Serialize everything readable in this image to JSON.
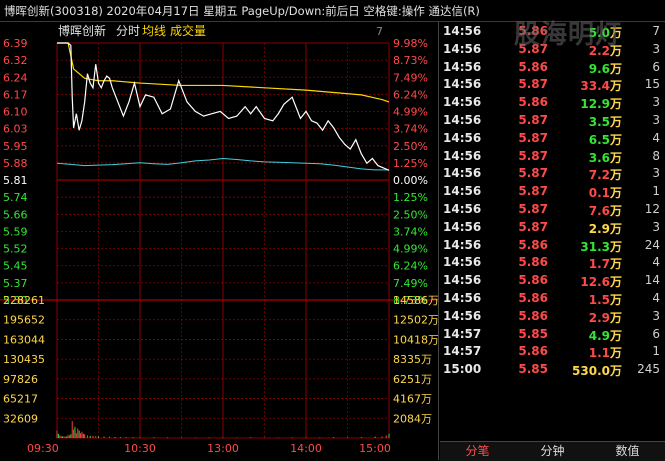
{
  "header": {
    "title": "博晖创新(300318)  2020年04月17日 星期五 PageUp/Down:前后日 空格键:操作 通达信(R)"
  },
  "watermark": "股海明灯",
  "legend": {
    "name": "博晖创新",
    "mode": "分时",
    "avg": "均线",
    "vol": "成交量",
    "corner": "7"
  },
  "colors": {
    "up": "#ff4a4a",
    "down": "#33e633",
    "base": "#ffffff",
    "price_line": "#ffffff",
    "avg_line": "#ffd700",
    "ref_line": "#40d0e0",
    "grid": "#8b0000",
    "volume_label": "#ffd84a"
  },
  "chart_data": {
    "type": "line",
    "base_price": 5.81,
    "price_ylim": [
      5.3,
      6.39
    ],
    "price_ticks_left": [
      "6.39",
      "6.32",
      "6.24",
      "6.17",
      "6.10",
      "6.03",
      "5.95",
      "5.88",
      "5.81",
      "5.74",
      "5.66",
      "5.59",
      "5.52",
      "5.45",
      "5.37",
      "5.30"
    ],
    "pct_ticks_right": [
      "9.98%",
      "8.73%",
      "7.49%",
      "6.24%",
      "4.99%",
      "3.74%",
      "2.50%",
      "1.25%",
      "0.00%",
      "1.25%",
      "2.50%",
      "3.74%",
      "4.99%",
      "6.24%",
      "7.49%",
      "8.73%"
    ],
    "volume_ticks_left": [
      "228261",
      "195652",
      "163044",
      "130435",
      "97826",
      "65217",
      "32609"
    ],
    "volume_ticks_right": [
      "14586万",
      "12502万",
      "10418万",
      "8335万",
      "6251万",
      "4167万",
      "2084万"
    ],
    "time_labels": [
      "09:30",
      "10:30",
      "13:00",
      "14:00",
      "15:00"
    ],
    "x_ticks": [
      0,
      60,
      120,
      180,
      240
    ],
    "volume_ylim": [
      0,
      260870
    ],
    "price_series": {
      "name": "博晖创新",
      "x": [
        0,
        3,
        6,
        8,
        10,
        11,
        12,
        14,
        16,
        18,
        20,
        22,
        24,
        26,
        28,
        30,
        32,
        34,
        36,
        38,
        40,
        44,
        48,
        52,
        56,
        60,
        64,
        70,
        76,
        82,
        88,
        94,
        100,
        106,
        112,
        118,
        124,
        130,
        136,
        140,
        144,
        150,
        156,
        160,
        164,
        170,
        176,
        180,
        184,
        188,
        192,
        196,
        200,
        204,
        208,
        212,
        216,
        220,
        224,
        228,
        232,
        236,
        240
      ],
      "y": [
        6.39,
        6.39,
        6.39,
        6.39,
        6.38,
        6.16,
        6.03,
        6.09,
        6.02,
        6.06,
        6.14,
        6.26,
        6.22,
        6.2,
        6.3,
        6.22,
        6.2,
        6.23,
        6.25,
        6.24,
        6.2,
        6.14,
        6.08,
        6.14,
        6.22,
        6.12,
        6.17,
        6.16,
        6.09,
        6.11,
        6.23,
        6.14,
        6.1,
        6.08,
        6.09,
        6.1,
        6.07,
        6.08,
        6.12,
        6.09,
        6.12,
        6.07,
        6.06,
        6.09,
        6.13,
        6.16,
        6.07,
        6.1,
        6.06,
        6.05,
        6.02,
        6.06,
        6.03,
        5.99,
        5.96,
        5.94,
        5.98,
        5.92,
        5.88,
        5.9,
        5.87,
        5.86,
        5.85
      ]
    },
    "avg_series": {
      "name": "均线",
      "x": [
        0,
        8,
        12,
        20,
        30,
        40,
        60,
        90,
        120,
        150,
        180,
        200,
        220,
        235,
        240
      ],
      "y": [
        6.39,
        6.39,
        6.28,
        6.24,
        6.23,
        6.23,
        6.22,
        6.21,
        6.21,
        6.2,
        6.19,
        6.18,
        6.17,
        6.15,
        6.14
      ]
    },
    "ref_series": {
      "x": [
        0,
        10,
        20,
        30,
        40,
        50,
        60,
        70,
        80,
        90,
        100,
        110,
        120,
        130,
        140,
        150,
        160,
        170,
        180,
        190,
        200,
        210,
        220,
        230,
        240
      ],
      "y": [
        5.88,
        5.875,
        5.87,
        5.872,
        5.874,
        5.878,
        5.882,
        5.878,
        5.875,
        5.882,
        5.89,
        5.894,
        5.9,
        5.896,
        5.89,
        5.886,
        5.884,
        5.882,
        5.88,
        5.878,
        5.872,
        5.864,
        5.856,
        5.852,
        5.852
      ]
    },
    "volume_series": {
      "x": [
        0,
        1,
        2,
        3,
        4,
        5,
        6,
        7,
        8,
        9,
        10,
        11,
        12,
        13,
        14,
        15,
        16,
        17,
        18,
        19,
        20,
        22,
        24,
        26,
        28,
        30,
        34,
        38,
        42,
        46,
        50,
        55,
        60,
        70,
        80,
        90,
        100,
        110,
        120,
        130,
        140,
        150,
        160,
        170,
        180,
        190,
        200,
        210,
        220,
        230,
        235,
        238,
        240
      ],
      "v": [
        14000,
        8000,
        5000,
        4000,
        3000,
        3000,
        2500,
        3000,
        6000,
        5000,
        7000,
        32000,
        16000,
        21000,
        9000,
        18000,
        14000,
        9000,
        12000,
        8000,
        7000,
        5000,
        4000,
        4000,
        3500,
        3000,
        3000,
        2500,
        2000,
        2000,
        2000,
        1500,
        1500,
        1500,
        1200,
        1200,
        1000,
        1000,
        1000,
        1000,
        1200,
        1000,
        1000,
        1000,
        1200,
        1200,
        1500,
        1500,
        2000,
        2500,
        3000,
        5000,
        8000
      ]
    }
  },
  "ticks": {
    "rows": [
      {
        "time": "14:56",
        "price": "5.86",
        "vol": "5.0",
        "unit": "万",
        "cnt": "7",
        "dir": "down"
      },
      {
        "time": "14:56",
        "price": "5.87",
        "vol": "2.2",
        "unit": "万",
        "cnt": "3",
        "dir": "up"
      },
      {
        "time": "14:56",
        "price": "5.86",
        "vol": "9.6",
        "unit": "万",
        "cnt": "6",
        "dir": "down"
      },
      {
        "time": "14:56",
        "price": "5.87",
        "vol": "33.4",
        "unit": "万",
        "cnt": "15",
        "dir": "up"
      },
      {
        "time": "14:56",
        "price": "5.86",
        "vol": "12.9",
        "unit": "万",
        "cnt": "3",
        "dir": "down"
      },
      {
        "time": "14:56",
        "price": "5.87",
        "vol": "3.5",
        "unit": "万",
        "cnt": "3",
        "dir": "down"
      },
      {
        "time": "14:56",
        "price": "5.87",
        "vol": "6.5",
        "unit": "万",
        "cnt": "4",
        "dir": "down"
      },
      {
        "time": "14:56",
        "price": "5.87",
        "vol": "3.6",
        "unit": "万",
        "cnt": "8",
        "dir": "down"
      },
      {
        "time": "14:56",
        "price": "5.87",
        "vol": "7.2",
        "unit": "万",
        "cnt": "3",
        "dir": "up"
      },
      {
        "time": "14:56",
        "price": "5.87",
        "vol": "0.1",
        "unit": "万",
        "cnt": "1",
        "dir": "up"
      },
      {
        "time": "14:56",
        "price": "5.87",
        "vol": "7.6",
        "unit": "万",
        "cnt": "12",
        "dir": "up"
      },
      {
        "time": "14:56",
        "price": "5.87",
        "vol": "2.9",
        "unit": "万",
        "cnt": "3",
        "dir": "flat"
      },
      {
        "time": "14:56",
        "price": "5.86",
        "vol": "31.3",
        "unit": "万",
        "cnt": "24",
        "dir": "down"
      },
      {
        "time": "14:56",
        "price": "5.86",
        "vol": "1.7",
        "unit": "万",
        "cnt": "4",
        "dir": "up"
      },
      {
        "time": "14:56",
        "price": "5.86",
        "vol": "12.6",
        "unit": "万",
        "cnt": "14",
        "dir": "up"
      },
      {
        "time": "14:56",
        "price": "5.86",
        "vol": "1.5",
        "unit": "万",
        "cnt": "4",
        "dir": "up"
      },
      {
        "time": "14:56",
        "price": "5.86",
        "vol": "2.9",
        "unit": "万",
        "cnt": "3",
        "dir": "up"
      },
      {
        "time": "14:57",
        "price": "5.85",
        "vol": "4.9",
        "unit": "万",
        "cnt": "6",
        "dir": "down"
      },
      {
        "time": "14:57",
        "price": "5.86",
        "vol": "1.1",
        "unit": "万",
        "cnt": "1",
        "dir": "up"
      },
      {
        "time": "15:00",
        "price": "5.85",
        "vol": "530.0",
        "unit": "万",
        "cnt": "245",
        "dir": "flat"
      }
    ]
  },
  "tabs": [
    {
      "label": "分笔",
      "active": true
    },
    {
      "label": "分钟",
      "active": false
    },
    {
      "label": "数值",
      "active": false
    }
  ]
}
